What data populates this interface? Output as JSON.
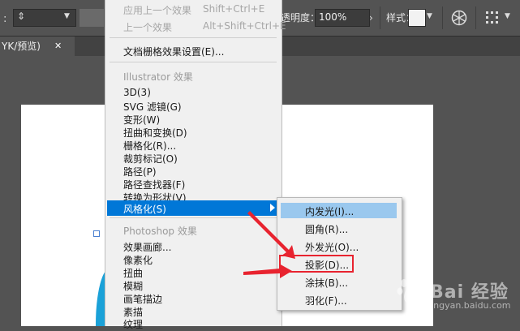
{
  "control_bar": {
    "opacity_label": "透明度：",
    "opacity_value": "100%",
    "style_label": "样式："
  },
  "document_tab": {
    "title": "YK/预览)",
    "close_glyph": "✕"
  },
  "effect_menu": {
    "apply_last": {
      "label": "应用上一个效果",
      "shortcut": "Shift+Ctrl+E"
    },
    "last_effect": {
      "label": "上一个效果",
      "shortcut": "Alt+Shift+Ctrl+E"
    },
    "raster_settings": "文档栅格效果设置(E)...",
    "illustrator_header": "Illustrator 效果",
    "illustrator_items": [
      "3D(3)",
      "SVG 滤镜(G)",
      "变形(W)",
      "扭曲和变换(D)",
      "栅格化(R)...",
      "裁剪标记(O)",
      "路径(P)",
      "路径查找器(F)",
      "转换为形状(V)"
    ],
    "highlighted_item": "风格化(S)",
    "photoshop_header": "Photoshop 效果",
    "photoshop_items": [
      "效果画廊...",
      "像素化",
      "扭曲",
      "模糊",
      "画笔描边",
      "素描",
      "纹理"
    ]
  },
  "stylize_submenu": {
    "items": [
      "内发光(I)...",
      "圆角(R)...",
      "外发光(O)...",
      "投影(D)...",
      "涂抹(B)...",
      "羽化(F)..."
    ]
  },
  "watermark": {
    "brand": "Bai 经验",
    "url": "jingyan.baidu.com"
  },
  "colors": {
    "menu_bg": "#f0f0f0",
    "highlight": "#0077d7",
    "submenu_highlight": "#9ac8ee",
    "annotation_red": "#e8232f",
    "app_bg": "#535353"
  }
}
